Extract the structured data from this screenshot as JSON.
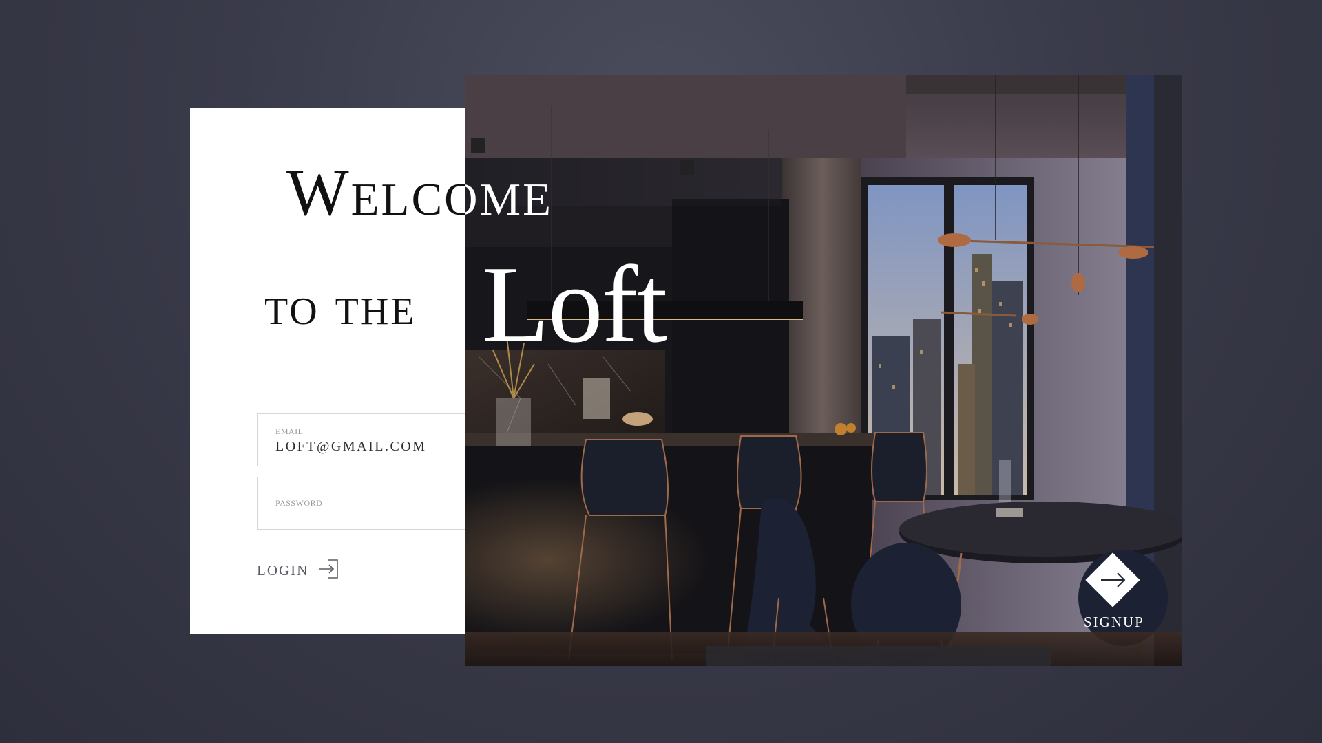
{
  "headline": {
    "line1": "Welcome",
    "line2": "to the",
    "brand": "Loft"
  },
  "form": {
    "email_label": "EMAIL",
    "email_value": "LOFT@GMAIL.COM",
    "password_label": "PASSWORD",
    "password_value": "",
    "login_label": "LOGIN",
    "login_icon": "login-arrow-icon"
  },
  "signup": {
    "label": "SIGNUP",
    "icon": "arrow-right-icon"
  },
  "colors": {
    "background": "#3a3b4a",
    "card": "#ffffff",
    "headline_dark": "#111111",
    "headline_light": "#ffffff"
  }
}
